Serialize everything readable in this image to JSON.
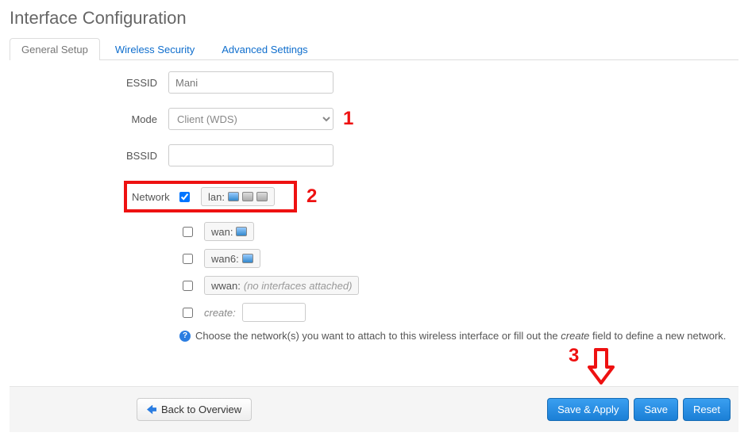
{
  "title": "Interface Configuration",
  "tabs": {
    "general": "General Setup",
    "security": "Wireless Security",
    "advanced": "Advanced Settings"
  },
  "form": {
    "essid_label": "ESSID",
    "essid_value": "Mani",
    "mode_label": "Mode",
    "mode_value": "Client (WDS)",
    "bssid_label": "BSSID",
    "bssid_value": "",
    "network_label": "Network"
  },
  "networks": {
    "lan": {
      "label": "lan:",
      "checked": true
    },
    "wan": {
      "label": "wan:",
      "checked": false
    },
    "wan6": {
      "label": "wan6:",
      "checked": false
    },
    "wwan": {
      "label": "wwan:",
      "note": "(no interfaces attached)",
      "checked": false
    },
    "create": {
      "label": "create:",
      "checked": false
    }
  },
  "hint": {
    "pre": "Choose the network(s) you want to attach to this wireless interface or fill out the ",
    "em": "create",
    "post": " field to define a new network."
  },
  "annot": {
    "one": "1",
    "two": "2",
    "three": "3"
  },
  "footer": {
    "back": "Back to Overview",
    "save_apply": "Save & Apply",
    "save": "Save",
    "reset": "Reset"
  }
}
